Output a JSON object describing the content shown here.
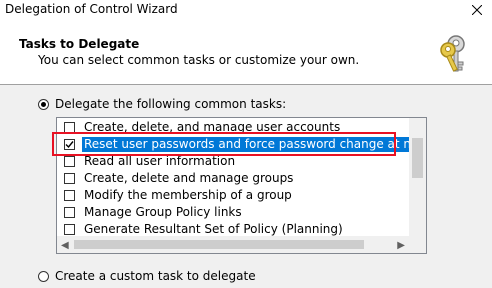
{
  "window": {
    "title": "Delegation of Control Wizard"
  },
  "header": {
    "title": "Tasks to Delegate",
    "subtitle": "You can select common tasks or customize your own."
  },
  "options": {
    "common_label": "Delegate the following common tasks:",
    "common_selected": true,
    "custom_label": "Create a custom task to delegate",
    "custom_selected": false
  },
  "tasks": [
    {
      "label": "Create, delete, and manage user accounts",
      "checked": false,
      "selected": false
    },
    {
      "label": "Reset user passwords and force password change at next logon",
      "checked": true,
      "selected": true
    },
    {
      "label": "Read all user information",
      "checked": false,
      "selected": false
    },
    {
      "label": "Create, delete and manage groups",
      "checked": false,
      "selected": false
    },
    {
      "label": "Modify the membership of a group",
      "checked": false,
      "selected": false
    },
    {
      "label": "Manage Group Policy links",
      "checked": false,
      "selected": false
    },
    {
      "label": "Generate Resultant Set of Policy (Planning)",
      "checked": false,
      "selected": false
    }
  ],
  "colors": {
    "selection": "#0078d7",
    "highlight_border": "#e81123"
  },
  "icons": {
    "close": "close-icon",
    "header": "keys-icon"
  }
}
